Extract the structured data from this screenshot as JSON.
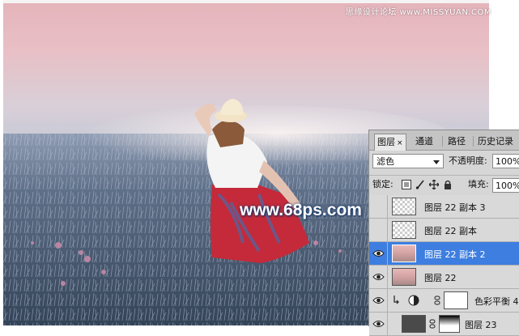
{
  "watermarks": {
    "top_right": "思缘设计论坛 www.MISSYUAN.COM",
    "center": "www.68ps.com"
  },
  "layers_panel": {
    "tabs": [
      {
        "label": "图层",
        "close": "×",
        "active": true
      },
      {
        "label": "通道"
      },
      {
        "label": "路径"
      },
      {
        "label": "历史记录"
      }
    ],
    "blend_mode": "滤色",
    "opacity_label": "不透明度:",
    "opacity_value": "100%",
    "lock_label": "锁定:",
    "fill_label": "填充:",
    "fill_value": "100%",
    "layers": [
      {
        "name": "图层 22 副本 3",
        "visible": false,
        "selected": false
      },
      {
        "name": "图层 22 副本",
        "visible": false,
        "selected": false
      },
      {
        "name": "图层 22 副本 2",
        "visible": true,
        "selected": true
      },
      {
        "name": "图层 22",
        "visible": true,
        "selected": false
      },
      {
        "name": "色彩平衡 4",
        "visible": true,
        "selected": false
      },
      {
        "name": "图层 23",
        "visible": true,
        "selected": false
      }
    ]
  },
  "colors": {
    "selection": "#3d7ee0",
    "panel_bg": "#d6d6d6",
    "sky_pink": "#e7b9c0"
  }
}
